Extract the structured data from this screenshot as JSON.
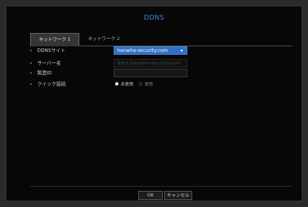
{
  "dialog": {
    "title": "DDNS"
  },
  "tabs": [
    {
      "label": "ネットワーク 1",
      "active": true
    },
    {
      "label": "ネットワーク 2",
      "active": false
    }
  ],
  "form": {
    "ddns_site": {
      "label": "DDNSサイト",
      "value": "hanwha-security.com",
      "icon": "chevron-down-icon"
    },
    "server_name": {
      "label": "サーバー名",
      "value": "ddns.hanwha-security.com"
    },
    "product_id": {
      "label": "製造ID",
      "value": ""
    },
    "quick_connect": {
      "label": "クイック接続",
      "options": [
        "未使用",
        "使用"
      ],
      "selected": "未使用"
    }
  },
  "buttons": {
    "ok": "OK",
    "cancel": "キャンセル"
  },
  "colors": {
    "title": "#3b86d8",
    "select_bg": "#2f6fc4",
    "background": "#070707"
  }
}
